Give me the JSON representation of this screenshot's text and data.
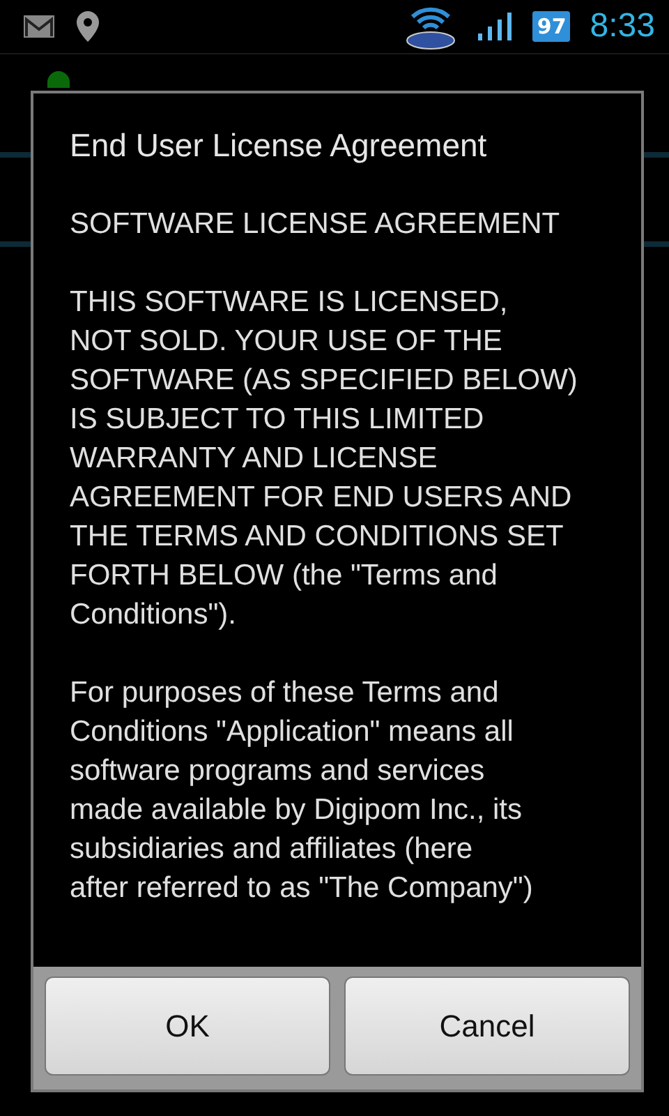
{
  "status_bar": {
    "battery": "97",
    "time": "8:33"
  },
  "dialog": {
    "title": "End User License Agreement",
    "paragraphs": [
      "SOFTWARE LICENSE AGREEMENT",
      "THIS SOFTWARE IS LICENSED,\nNOT SOLD. YOUR USE OF THE\nSOFTWARE (AS SPECIFIED BELOW)\nIS SUBJECT TO THIS LIMITED\nWARRANTY AND LICENSE\nAGREEMENT FOR END USERS AND\nTHE TERMS AND CONDITIONS SET\nFORTH BELOW (the \"Terms and\nConditions\").",
      "For purposes of these Terms and\nConditions \"Application\" means all\nsoftware programs and services\nmade available by Digipom Inc., its\nsubsidiaries and affiliates (here\nafter referred to as \"The Company\")"
    ],
    "buttons": [
      "OK",
      "Cancel"
    ]
  }
}
